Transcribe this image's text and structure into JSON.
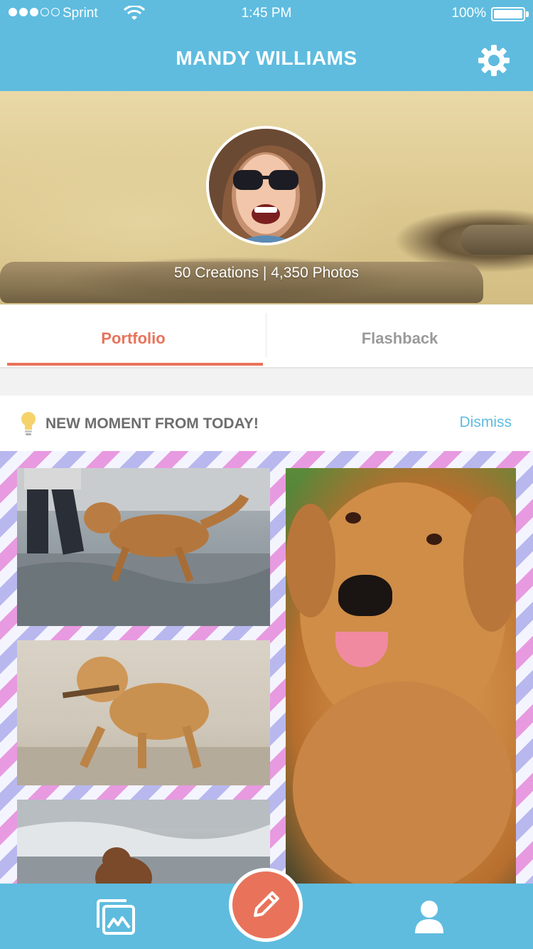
{
  "status_bar": {
    "carrier": "Sprint",
    "time": "1:45 PM",
    "battery": "100%",
    "signal_bars": 3,
    "signal_total": 5
  },
  "header": {
    "title": "MANDY WILLIAMS",
    "settings_icon": "gear-icon"
  },
  "profile": {
    "stats": "50 Creations | 4,350 Photos"
  },
  "tabs": [
    {
      "label": "Portfolio",
      "active": true
    },
    {
      "label": "Flashback",
      "active": false
    }
  ],
  "moment": {
    "title": "NEW MOMENT FROM TODAY!",
    "dismiss_label": "Dismiss",
    "icon": "lightbulb-icon"
  },
  "bottom_nav": {
    "left_icon": "gallery-icon",
    "center_icon": "pencil-icon",
    "right_icon": "profile-icon"
  },
  "colors": {
    "primary": "#5fbcdf",
    "accent": "#e8735a",
    "muted_tab": "#9a9a9a"
  }
}
